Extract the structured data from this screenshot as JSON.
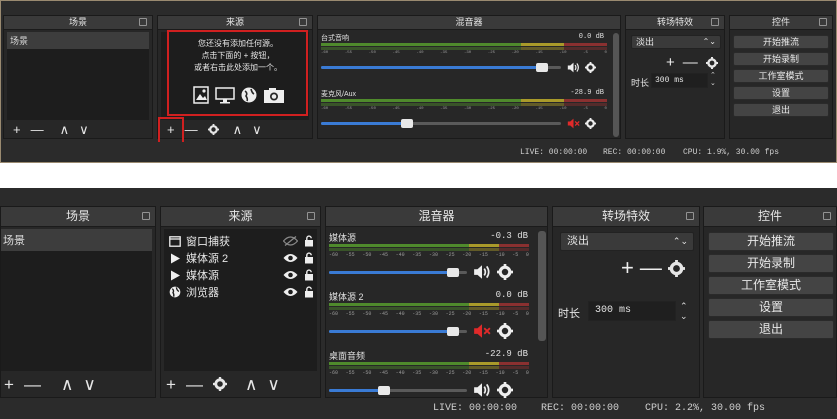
{
  "top": {
    "docks": {
      "scenes": "场景",
      "sources": "来源",
      "mixer": "混音器",
      "transitions": "转场特效",
      "controls": "控件"
    },
    "scene_list": [
      "场景"
    ],
    "empty_sources_hint": [
      "您还没有添加任何源。",
      "点击下面的 + 按钮，",
      "或者右击此处添加一个。"
    ],
    "mixer_channels": [
      {
        "name": "台式音响",
        "db": "0.0 dB",
        "level": 0.92,
        "muted": false
      },
      {
        "name": "麦克风/Aux",
        "db": "-28.9 dB",
        "level": 0.36,
        "muted": true
      }
    ],
    "ticks": [
      "-60",
      "-55",
      "-50",
      "-45",
      "-40",
      "-35",
      "-30",
      "-25",
      "-20",
      "-15",
      "-10",
      "-5",
      "0"
    ],
    "transition": {
      "selected": "淡出",
      "duration_label": "时长",
      "duration_value": "300 ms"
    },
    "controls": [
      "开始推流",
      "开始录制",
      "工作室模式",
      "设置",
      "退出"
    ],
    "status": {
      "live": "LIVE: 00:00:00",
      "rec": "REC: 00:00:00",
      "cpu": "CPU: 1.9%, 30.00 fps"
    },
    "toolbar": {
      "add": "+",
      "remove": "—",
      "up": "∧",
      "down": "∨"
    }
  },
  "bottom": {
    "docks": {
      "scenes": "场景",
      "sources": "来源",
      "mixer": "混音器",
      "transitions": "转场特效",
      "controls": "控件"
    },
    "scene_list": [
      "场景"
    ],
    "sources": [
      {
        "name": "窗口捕获",
        "icon": "window-capture-icon",
        "visible": false
      },
      {
        "name": "媒体源 2",
        "icon": "play-icon",
        "visible": true
      },
      {
        "name": "媒体源",
        "icon": "play-icon",
        "visible": true
      },
      {
        "name": "浏览器",
        "icon": "globe-icon",
        "visible": true
      }
    ],
    "mixer_channels": [
      {
        "name": "媒体源",
        "db": "-0.3 dB",
        "level": 0.9,
        "muted": false
      },
      {
        "name": "媒体源 2",
        "db": "0.0 dB",
        "level": 0.9,
        "muted": true
      },
      {
        "name": "桌面音频",
        "db": "-22.9 dB",
        "level": 0.4,
        "muted": false
      }
    ],
    "ticks": [
      "-60",
      "-55",
      "-50",
      "-45",
      "-40",
      "-35",
      "-30",
      "-25",
      "-20",
      "-15",
      "-10",
      "-5",
      "0"
    ],
    "transition": {
      "selected": "淡出",
      "duration_label": "时长",
      "duration_value": "300 ms"
    },
    "controls": [
      "开始推流",
      "开始录制",
      "工作室模式",
      "设置",
      "退出"
    ],
    "status": {
      "live": "LIVE: 00:00:00",
      "rec": "REC: 00:00:00",
      "cpu": "CPU: 2.2%, 30.00 fps"
    },
    "toolbar": {
      "add": "+",
      "remove": "—",
      "up": "∧",
      "down": "∨"
    }
  },
  "colors": {
    "highlight": "#d02020",
    "mute_red": "#e02a2a",
    "slider_blue": "#3a7bd5"
  }
}
